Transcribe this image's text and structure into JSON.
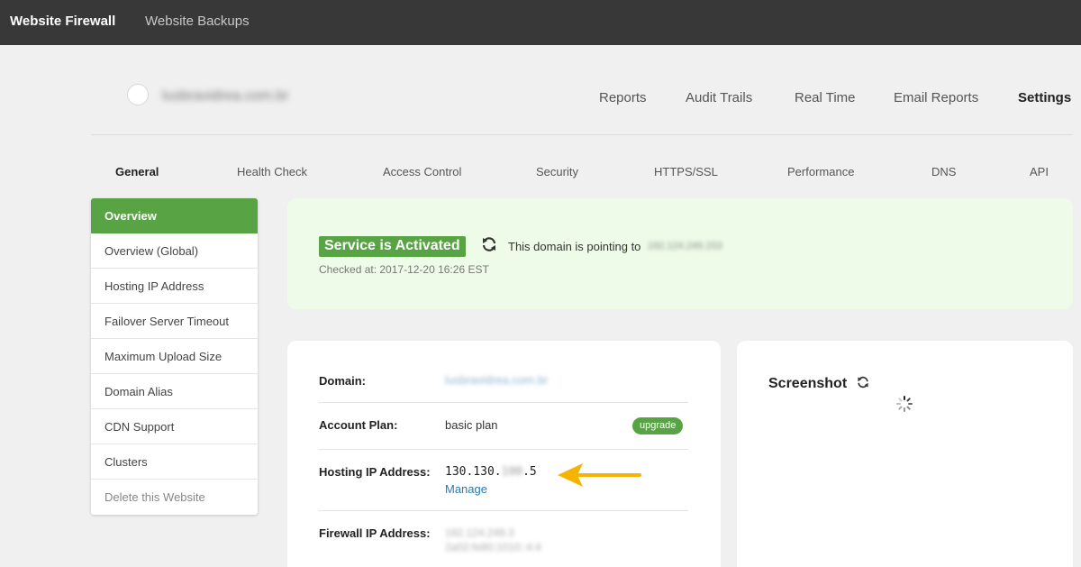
{
  "topbar": {
    "brand": "Website Firewall",
    "backups": "Website Backups"
  },
  "site": {
    "name": "lusbravidrea.com.br"
  },
  "main_nav": [
    "Reports",
    "Audit Trails",
    "Real Time",
    "Email Reports",
    "Settings"
  ],
  "sub_tabs": [
    "General",
    "Health Check",
    "Access Control",
    "Security",
    "HTTPS/SSL",
    "Performance",
    "DNS",
    "API"
  ],
  "sidebar": {
    "items": [
      {
        "label": "Overview"
      },
      {
        "label": "Overview (Global)"
      },
      {
        "label": "Hosting IP Address"
      },
      {
        "label": "Failover Server Timeout"
      },
      {
        "label": "Maximum Upload Size"
      },
      {
        "label": "Domain Alias"
      },
      {
        "label": "CDN Support"
      },
      {
        "label": "Clusters"
      },
      {
        "label": "Delete this Website"
      }
    ]
  },
  "status": {
    "badge": "Service is Activated",
    "pointing_text": "This domain is pointing to",
    "pointing_ip": "192.124.249.153",
    "checked_at": "Checked at: 2017-12-20 16:26 EST"
  },
  "info": {
    "domain_label": "Domain:",
    "domain_value": "lusbravidrea.com.br",
    "plan_label": "Account Plan:",
    "plan_value": "basic plan",
    "upgrade_label": "upgrade",
    "hosting_label": "Hosting IP Address:",
    "hosting_ip_prefix": "130.130.",
    "hosting_ip_masked": "100",
    "hosting_ip_suffix": ".5",
    "manage_label": "Manage",
    "firewall_label": "Firewall IP Address:",
    "firewall_ip_1": "192.124.249.3",
    "firewall_ip_2": "2a02:fe80:1010::4:4"
  },
  "screenshot": {
    "title": "Screenshot"
  },
  "colors": {
    "topbar": "#383838",
    "accent_green": "#58a445",
    "status_bg": "#edfbe8",
    "arrow": "#f5b400",
    "link": "#2a7ab0"
  }
}
